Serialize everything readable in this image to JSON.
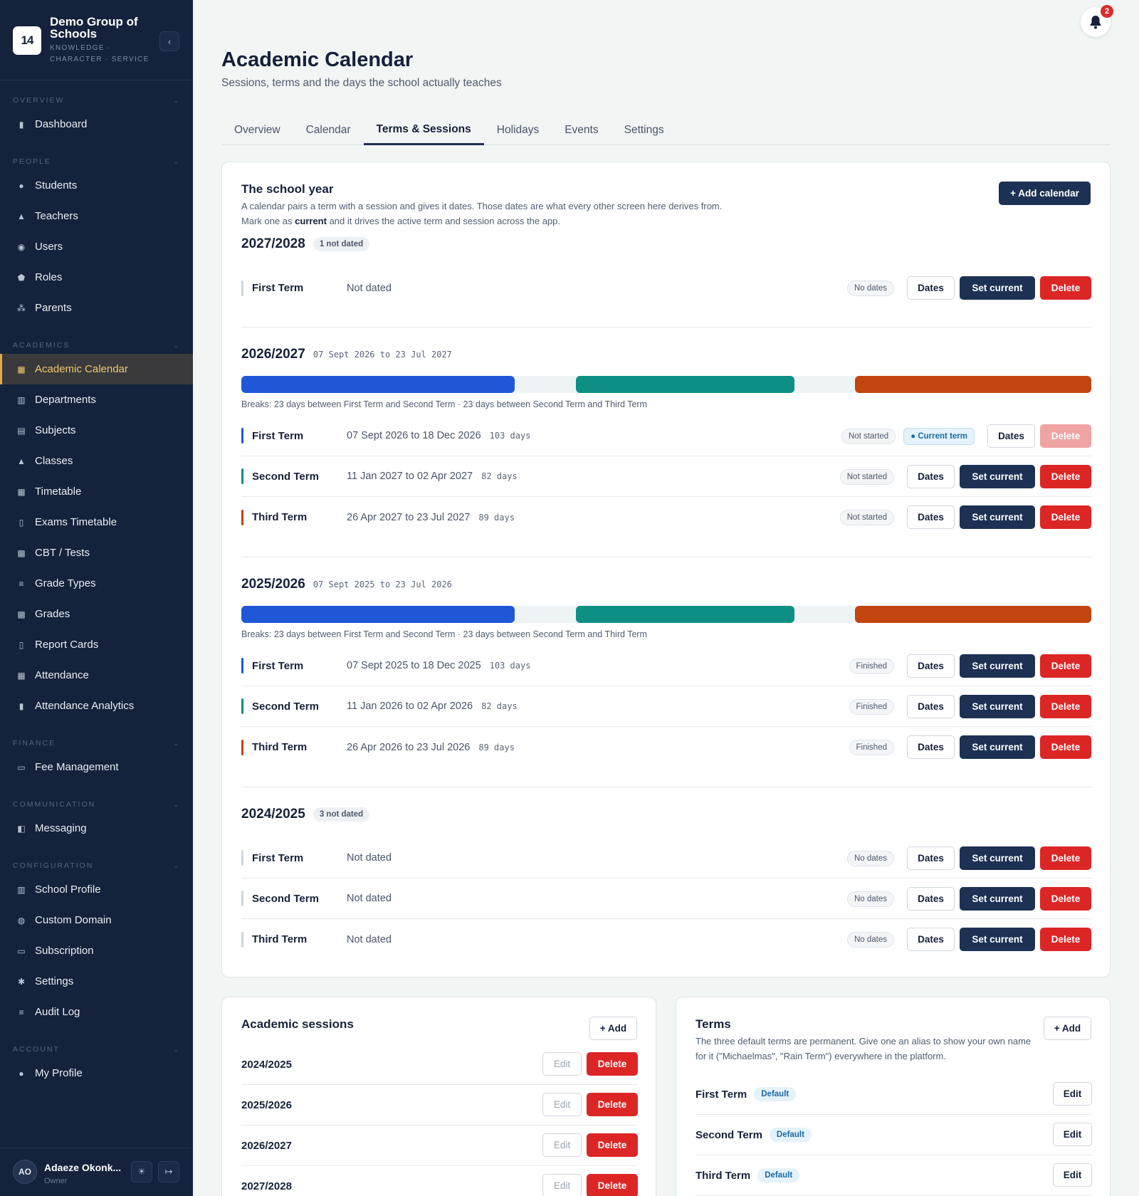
{
  "brand": {
    "name": "Demo Group of Schools",
    "tagline": "KNOWLEDGE · CHARACTER · SERVICE",
    "logo_text": "14"
  },
  "nav": [
    {
      "section": "OVERVIEW",
      "items": [
        {
          "label": "Dashboard",
          "icon": "bar-chart-icon"
        }
      ]
    },
    {
      "section": "PEOPLE",
      "items": [
        {
          "label": "Students",
          "icon": "person-icon"
        },
        {
          "label": "Teachers",
          "icon": "graduation-cap-icon"
        },
        {
          "label": "Users",
          "icon": "user-circle-icon"
        },
        {
          "label": "Roles",
          "icon": "shield-icon"
        },
        {
          "label": "Parents",
          "icon": "people-icon"
        }
      ]
    },
    {
      "section": "ACADEMICS",
      "items": [
        {
          "label": "Academic Calendar",
          "icon": "calendar-icon",
          "active": true
        },
        {
          "label": "Departments",
          "icon": "building-icon"
        },
        {
          "label": "Subjects",
          "icon": "book-icon"
        },
        {
          "label": "Classes",
          "icon": "graduation-cap-icon"
        },
        {
          "label": "Timetable",
          "icon": "calendar-icon"
        },
        {
          "label": "Exams Timetable",
          "icon": "document-icon"
        },
        {
          "label": "CBT / Tests",
          "icon": "calendar-check-icon"
        },
        {
          "label": "Grade Types",
          "icon": "list-icon"
        },
        {
          "label": "Grades",
          "icon": "calendar-check-icon"
        },
        {
          "label": "Report Cards",
          "icon": "document-icon"
        },
        {
          "label": "Attendance",
          "icon": "calendar-icon"
        },
        {
          "label": "Attendance Analytics",
          "icon": "bar-chart-icon"
        }
      ]
    },
    {
      "section": "FINANCE",
      "items": [
        {
          "label": "Fee Management",
          "icon": "card-icon"
        }
      ]
    },
    {
      "section": "COMMUNICATION",
      "items": [
        {
          "label": "Messaging",
          "icon": "chat-icon"
        }
      ]
    },
    {
      "section": "CONFIGURATION",
      "items": [
        {
          "label": "School Profile",
          "icon": "building-icon"
        },
        {
          "label": "Custom Domain",
          "icon": "globe-icon"
        },
        {
          "label": "Subscription",
          "icon": "card-icon"
        },
        {
          "label": "Settings",
          "icon": "gear-icon"
        },
        {
          "label": "Audit Log",
          "icon": "list-icon"
        }
      ]
    },
    {
      "section": "ACCOUNT",
      "items": [
        {
          "label": "My Profile",
          "icon": "person-icon"
        }
      ]
    }
  ],
  "user": {
    "initials": "AO",
    "name": "Adaeze Okonk...",
    "role": "Owner"
  },
  "notifications": {
    "count": "2"
  },
  "page": {
    "title": "Academic Calendar",
    "subtitle": "Sessions, terms and the days the school actually teaches"
  },
  "tabs": [
    {
      "label": "Overview"
    },
    {
      "label": "Calendar"
    },
    {
      "label": "Terms & Sessions",
      "active": true
    },
    {
      "label": "Holidays"
    },
    {
      "label": "Events"
    },
    {
      "label": "Settings"
    }
  ],
  "school_year": {
    "title": "The school year",
    "desc_a": "A calendar pairs a term with a session and gives it dates. Those dates are what every other screen here derives from. Mark one as ",
    "desc_bold": "current",
    "desc_b": " and it drives the active term and session across the app.",
    "add_label": "+ Add calendar"
  },
  "labels": {
    "dates": "Dates",
    "set_current": "Set current",
    "delete": "Delete",
    "edit": "Edit",
    "add": "+ Add",
    "current_term": "● Current term",
    "default": "Default"
  },
  "colors": {
    "first": "#1f57d6",
    "second": "#0e8f83",
    "third": "#c2440e"
  },
  "sessions": [
    {
      "name": "2027/2028",
      "pill": "1 not dated",
      "terms": [
        {
          "name": "First Term",
          "dates": "Not dated",
          "status": "No dates",
          "undated": true
        }
      ]
    },
    {
      "name": "2026/2027",
      "range": "07 Sept 2026 to 23 Jul 2027",
      "breaks": "Breaks: 23 days between First Term and Second Term · 23 days between Second Term and Third Term",
      "segments": [
        {
          "start": 0.0,
          "end": 0.322,
          "color": "first"
        },
        {
          "start": 0.394,
          "end": 0.651,
          "color": "second"
        },
        {
          "start": 0.722,
          "end": 1.0,
          "color": "third"
        }
      ],
      "terms": [
        {
          "name": "First Term",
          "dates": "07 Sept 2026 to 18 Dec 2026",
          "days": "103 days",
          "status": "Not started",
          "color": "first",
          "current": true
        },
        {
          "name": "Second Term",
          "dates": "11 Jan 2027 to 02 Apr 2027",
          "days": "82 days",
          "status": "Not started",
          "color": "second"
        },
        {
          "name": "Third Term",
          "dates": "26 Apr 2027 to 23 Jul 2027",
          "days": "89 days",
          "status": "Not started",
          "color": "third"
        }
      ]
    },
    {
      "name": "2025/2026",
      "range": "07 Sept 2025 to 23 Jul 2026",
      "breaks": "Breaks: 23 days between First Term and Second Term · 23 days between Second Term and Third Term",
      "segments": [
        {
          "start": 0.0,
          "end": 0.322,
          "color": "first"
        },
        {
          "start": 0.394,
          "end": 0.651,
          "color": "second"
        },
        {
          "start": 0.722,
          "end": 1.0,
          "color": "third"
        }
      ],
      "terms": [
        {
          "name": "First Term",
          "dates": "07 Sept 2025 to 18 Dec 2025",
          "days": "103 days",
          "status": "Finished",
          "color": "first"
        },
        {
          "name": "Second Term",
          "dates": "11 Jan 2026 to 02 Apr 2026",
          "days": "82 days",
          "status": "Finished",
          "color": "second"
        },
        {
          "name": "Third Term",
          "dates": "26 Apr 2026 to 23 Jul 2026",
          "days": "89 days",
          "status": "Finished",
          "color": "third"
        }
      ]
    },
    {
      "name": "2024/2025",
      "pill": "3 not dated",
      "terms": [
        {
          "name": "First Term",
          "dates": "Not dated",
          "status": "No dates",
          "undated": true
        },
        {
          "name": "Second Term",
          "dates": "Not dated",
          "status": "No dates",
          "undated": true
        },
        {
          "name": "Third Term",
          "dates": "Not dated",
          "status": "No dates",
          "undated": true
        }
      ]
    }
  ],
  "academic_sessions": {
    "title": "Academic sessions",
    "items": [
      "2024/2025",
      "2025/2026",
      "2026/2027",
      "2027/2028"
    ]
  },
  "terms_card": {
    "title": "Terms",
    "desc": "The three default terms are permanent. Give one an alias to show your own name for it (\"Michaelmas\", \"Rain Term\") everywhere in the platform.",
    "items": [
      "First Term",
      "Second Term",
      "Third Term"
    ]
  }
}
